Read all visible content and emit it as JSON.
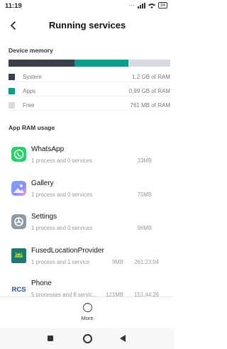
{
  "status_bar": {
    "time": "11:19",
    "signal": "..ıl",
    "battery": "34"
  },
  "header": {
    "title": "Running services"
  },
  "device_memory": {
    "label": "Device memory",
    "bar": {
      "system_color": "#3a4148",
      "apps_color": "#0a9d8a",
      "free_color": "#d7dbe0"
    },
    "legend": [
      {
        "name": "System",
        "value": "1.2 GB of RAM",
        "color": "#3a4148"
      },
      {
        "name": "Apps",
        "value": "0.99 GB of RAM",
        "color": "#0a9d8a"
      },
      {
        "name": "Free",
        "value": "761 MB of RAM",
        "color": "#d7dbe0"
      }
    ]
  },
  "app_ram": {
    "label": "App RAM usage",
    "apps": [
      {
        "name": "WhatsApp",
        "sub": "1 process and 0 services",
        "mem": "33MB",
        "icon": "whatsapp-icon"
      },
      {
        "name": "Gallery",
        "sub": "1 process and 0 services",
        "mem": "75MB",
        "icon": "gallery-icon"
      },
      {
        "name": "Settings",
        "sub": "1 process and 0 services",
        "mem": "96MB",
        "icon": "settings-icon"
      },
      {
        "name": "FusedLocationProvider",
        "sub": "1 process and 1 service",
        "mem": "9MB",
        "time": "261:23:04",
        "icon": "android-icon"
      },
      {
        "name": "Phone",
        "sub": "5 processes and 8 servic...",
        "mem": "121MB",
        "time": "151:44:26",
        "icon": "rcs-icon"
      }
    ]
  },
  "bottom": {
    "more_label": "More"
  }
}
